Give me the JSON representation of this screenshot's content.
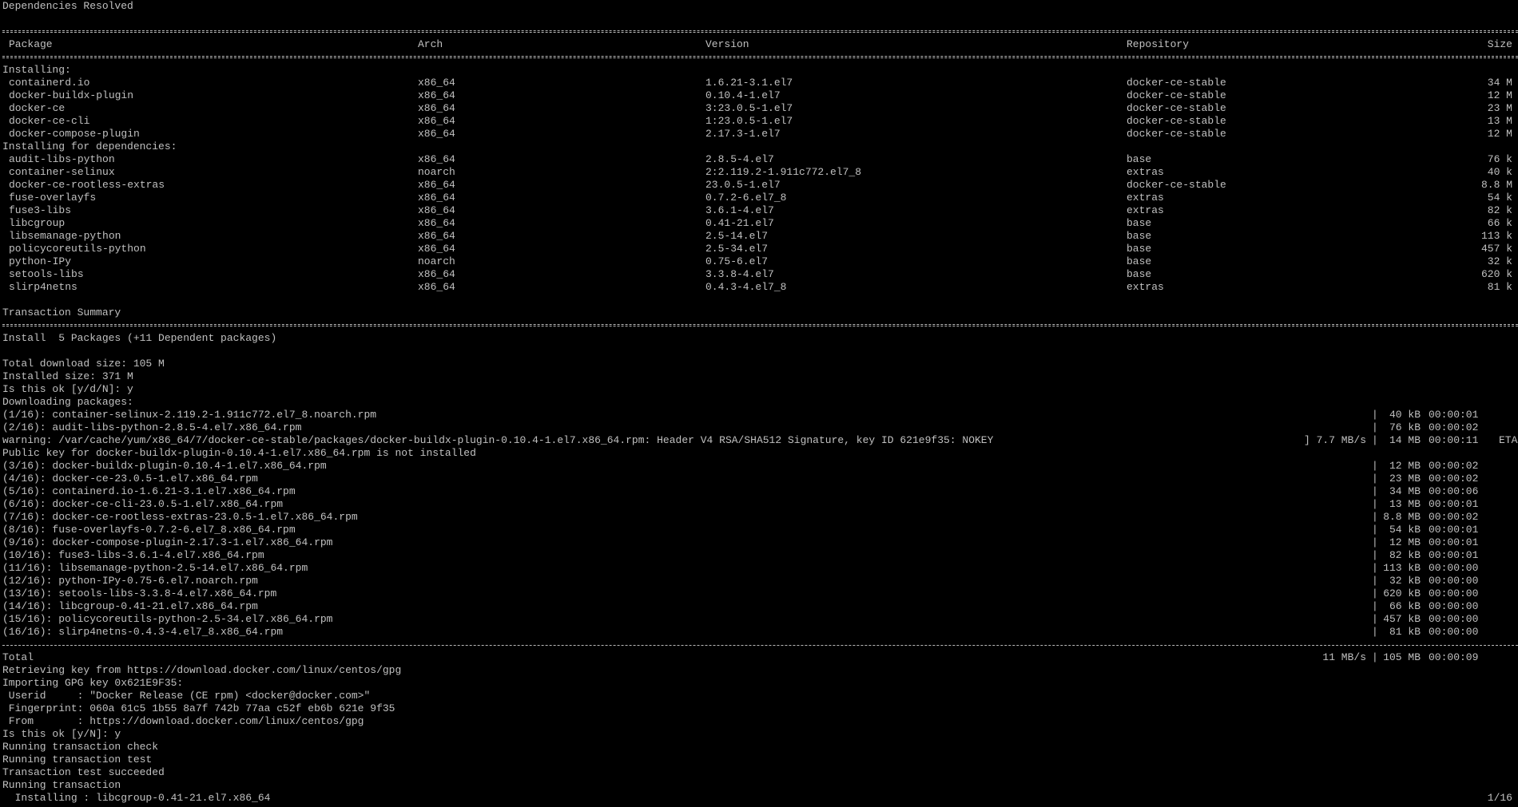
{
  "terminal": {
    "background": "#000000",
    "foreground": "#c0c0c0",
    "deps_resolved": "Dependencies Resolved",
    "headers": {
      "package": "Package",
      "arch": "Arch",
      "version": "Version",
      "repository": "Repository",
      "size": "Size"
    },
    "installing_label": "Installing:",
    "installing": [
      {
        "name": "containerd.io",
        "arch": "x86_64",
        "version": "1.6.21-3.1.el7",
        "repo": "docker-ce-stable",
        "size": "34 M"
      },
      {
        "name": "docker-buildx-plugin",
        "arch": "x86_64",
        "version": "0.10.4-1.el7",
        "repo": "docker-ce-stable",
        "size": "12 M"
      },
      {
        "name": "docker-ce",
        "arch": "x86_64",
        "version": "3:23.0.5-1.el7",
        "repo": "docker-ce-stable",
        "size": "23 M"
      },
      {
        "name": "docker-ce-cli",
        "arch": "x86_64",
        "version": "1:23.0.5-1.el7",
        "repo": "docker-ce-stable",
        "size": "13 M"
      },
      {
        "name": "docker-compose-plugin",
        "arch": "x86_64",
        "version": "2.17.3-1.el7",
        "repo": "docker-ce-stable",
        "size": "12 M"
      }
    ],
    "deps_label": "Installing for dependencies:",
    "dependencies": [
      {
        "name": "audit-libs-python",
        "arch": "x86_64",
        "version": "2.8.5-4.el7",
        "repo": "base",
        "size": "76 k"
      },
      {
        "name": "container-selinux",
        "arch": "noarch",
        "version": "2:2.119.2-1.911c772.el7_8",
        "repo": "extras",
        "size": "40 k"
      },
      {
        "name": "docker-ce-rootless-extras",
        "arch": "x86_64",
        "version": "23.0.5-1.el7",
        "repo": "docker-ce-stable",
        "size": "8.8 M"
      },
      {
        "name": "fuse-overlayfs",
        "arch": "x86_64",
        "version": "0.7.2-6.el7_8",
        "repo": "extras",
        "size": "54 k"
      },
      {
        "name": "fuse3-libs",
        "arch": "x86_64",
        "version": "3.6.1-4.el7",
        "repo": "extras",
        "size": "82 k"
      },
      {
        "name": "libcgroup",
        "arch": "x86_64",
        "version": "0.41-21.el7",
        "repo": "base",
        "size": "66 k"
      },
      {
        "name": "libsemanage-python",
        "arch": "x86_64",
        "version": "2.5-14.el7",
        "repo": "base",
        "size": "113 k"
      },
      {
        "name": "policycoreutils-python",
        "arch": "x86_64",
        "version": "2.5-34.el7",
        "repo": "base",
        "size": "457 k"
      },
      {
        "name": "python-IPy",
        "arch": "noarch",
        "version": "0.75-6.el7",
        "repo": "base",
        "size": "32 k"
      },
      {
        "name": "setools-libs",
        "arch": "x86_64",
        "version": "3.3.8-4.el7",
        "repo": "base",
        "size": "620 k"
      },
      {
        "name": "slirp4netns",
        "arch": "x86_64",
        "version": "0.4.3-4.el7_8",
        "repo": "extras",
        "size": "81 k"
      }
    ],
    "summary_title": "Transaction Summary",
    "summary_install": "Install  5 Packages (+11 Dependent packages)",
    "total_download": "Total download size: 105 M",
    "installed_size": "Installed size: 371 M",
    "prompt1": "Is this ok [y/d/N]: y",
    "downloading": "Downloading packages:",
    "downloads": [
      {
        "name": "(1/16): container-selinux-2.119.2-1.911c772.el7_8.noarch.rpm",
        "rate": "",
        "bar": "|",
        "size": "40 kB",
        "time": "00:00:01",
        "eta": ""
      },
      {
        "name": "(2/16): audit-libs-python-2.8.5-4.el7.x86_64.rpm",
        "rate": "",
        "bar": "|",
        "size": "76 kB",
        "time": "00:00:02",
        "eta": ""
      },
      {
        "name": "warning: /var/cache/yum/x86_64/7/docker-ce-stable/packages/docker-buildx-plugin-0.10.4-1.el7.x86_64.rpm: Header V4 RSA/SHA512 Signature, key ID 621e9f35: NOKEY",
        "rate": "] 7.7 MB/s",
        "bar": "|",
        "size": "14 MB",
        "time": "00:00:11",
        "eta": "ETA"
      }
    ],
    "pubkey_msg": "Public key for docker-buildx-plugin-0.10.4-1.el7.x86_64.rpm is not installed",
    "downloads2": [
      {
        "name": "(3/16): docker-buildx-plugin-0.10.4-1.el7.x86_64.rpm",
        "size": "12 MB",
        "time": "00:00:02"
      },
      {
        "name": "(4/16): docker-ce-23.0.5-1.el7.x86_64.rpm",
        "size": "23 MB",
        "time": "00:00:02"
      },
      {
        "name": "(5/16): containerd.io-1.6.21-3.1.el7.x86_64.rpm",
        "size": "34 MB",
        "time": "00:00:06"
      },
      {
        "name": "(6/16): docker-ce-cli-23.0.5-1.el7.x86_64.rpm",
        "size": "13 MB",
        "time": "00:00:01"
      },
      {
        "name": "(7/16): docker-ce-rootless-extras-23.0.5-1.el7.x86_64.rpm",
        "size": "8.8 MB",
        "time": "00:00:02"
      },
      {
        "name": "(8/16): fuse-overlayfs-0.7.2-6.el7_8.x86_64.rpm",
        "size": "54 kB",
        "time": "00:00:01"
      },
      {
        "name": "(9/16): docker-compose-plugin-2.17.3-1.el7.x86_64.rpm",
        "size": "12 MB",
        "time": "00:00:01"
      },
      {
        "name": "(10/16): fuse3-libs-3.6.1-4.el7.x86_64.rpm",
        "size": "82 kB",
        "time": "00:00:01"
      },
      {
        "name": "(11/16): libsemanage-python-2.5-14.el7.x86_64.rpm",
        "size": "113 kB",
        "time": "00:00:00"
      },
      {
        "name": "(12/16): python-IPy-0.75-6.el7.noarch.rpm",
        "size": "32 kB",
        "time": "00:00:00"
      },
      {
        "name": "(13/16): setools-libs-3.3.8-4.el7.x86_64.rpm",
        "size": "620 kB",
        "time": "00:00:00"
      },
      {
        "name": "(14/16): libcgroup-0.41-21.el7.x86_64.rpm",
        "size": "66 kB",
        "time": "00:00:00"
      },
      {
        "name": "(15/16): policycoreutils-python-2.5-34.el7.x86_64.rpm",
        "size": "457 kB",
        "time": "00:00:00"
      },
      {
        "name": "(16/16): slirp4netns-0.4.3-4.el7_8.x86_64.rpm",
        "size": "81 kB",
        "time": "00:00:00"
      }
    ],
    "bar_char": "|",
    "total_label": "Total",
    "total_rate": "11 MB/s",
    "total_size": "105 MB",
    "total_time": "00:00:09",
    "retrieving": "Retrieving key from https://download.docker.com/linux/centos/gpg",
    "importing": "Importing GPG key 0x621E9F35:",
    "userid": " Userid     : \"Docker Release (CE rpm) <docker@docker.com>\"",
    "fingerprint": " Fingerprint: 060a 61c5 1b55 8a7f 742b 77aa c52f eb6b 621e 9f35",
    "from": " From       : https://download.docker.com/linux/centos/gpg",
    "prompt2": "Is this ok [y/N]: y",
    "check": "Running transaction check",
    "test": "Running transaction test",
    "test_ok": "Transaction test succeeded",
    "running": "Running transaction",
    "installing_line": "  Installing : libcgroup-0.41-21.el7.x86_64",
    "installing_progress": "1/16"
  }
}
